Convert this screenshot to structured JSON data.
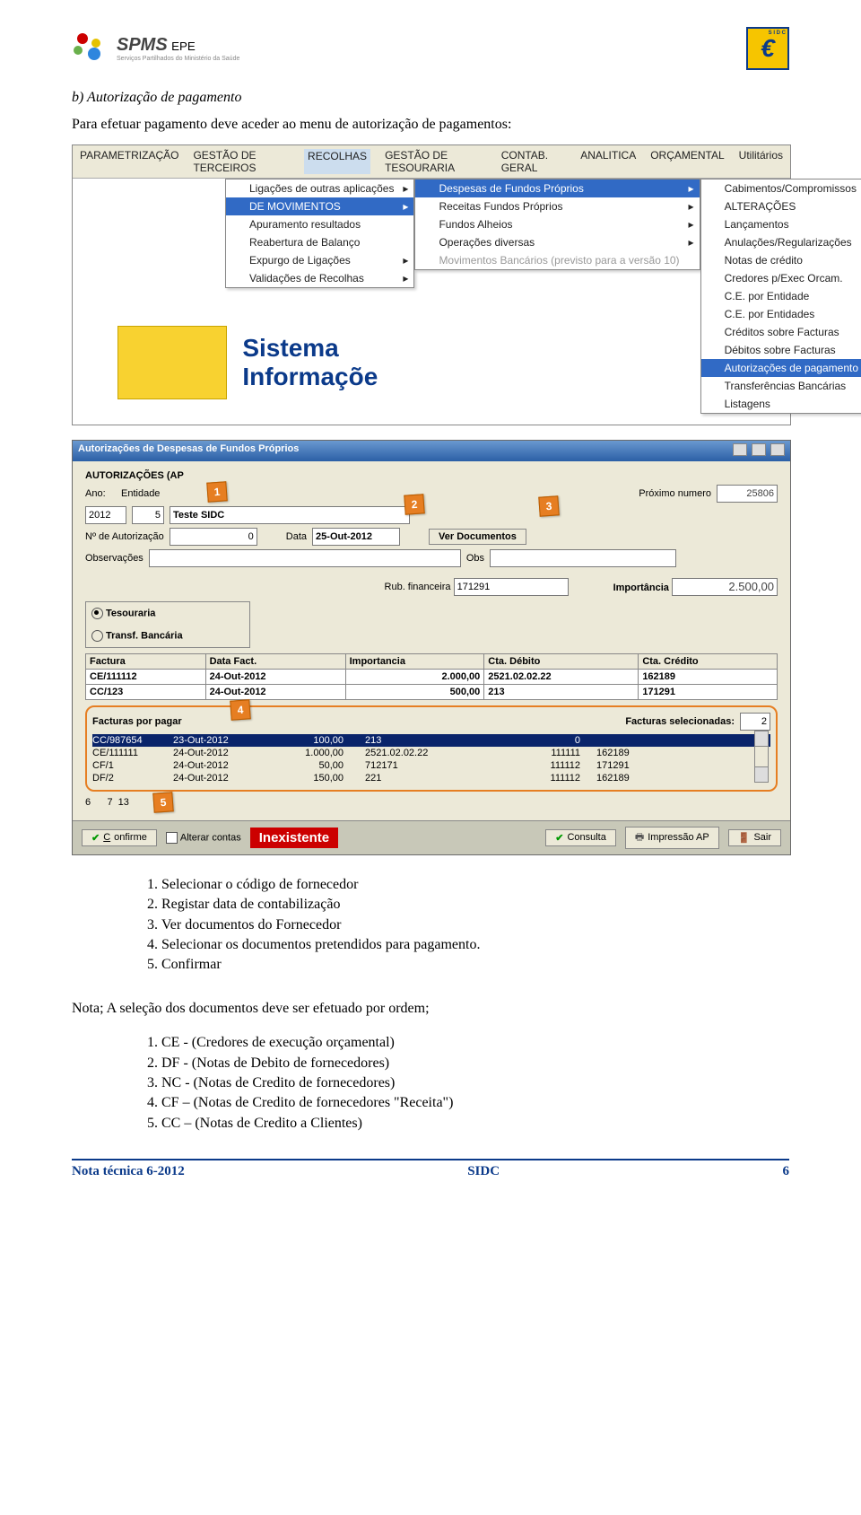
{
  "header": {
    "org_name": "SPMS",
    "org_suffix": "EPE",
    "org_sub": "Serviços Partilhados do Ministério da Saúde",
    "sidc_letters": "S I D C"
  },
  "section": {
    "bullet_b": "b)  Autorização de pagamento",
    "intro": "Para efetuar pagamento deve aceder ao menu de autorização de pagamentos:"
  },
  "menu": {
    "bar": [
      "PARAMETRIZAÇÃO",
      "GESTÃO DE TERCEIROS",
      "RECOLHAS",
      "GESTÃO DE TESOURARIA",
      "CONTAB. GERAL",
      "ANALITICA",
      "ORÇAMENTAL",
      "Utilitários"
    ],
    "col1": [
      {
        "label": "Ligações de outras aplicações",
        "arrow": true
      },
      {
        "label": "DE MOVIMENTOS",
        "arrow": true,
        "sel": true
      },
      {
        "label": "Apuramento resultados"
      },
      {
        "label": "Reabertura de Balanço"
      },
      {
        "label": "Expurgo de Ligações",
        "arrow": true
      },
      {
        "label": "Validações de Recolhas",
        "arrow": true
      }
    ],
    "col2": [
      {
        "label": "Despesas de Fundos Próprios",
        "arrow": true,
        "sel": true
      },
      {
        "label": "Receitas Fundos Próprios",
        "arrow": true
      },
      {
        "label": "Fundos Alheios",
        "arrow": true
      },
      {
        "label": "Operações diversas",
        "arrow": true
      },
      {
        "label": "Movimentos Bancários (previsto para a versão 10)",
        "dis": true
      }
    ],
    "col3": [
      {
        "label": "Cabimentos/Compromissos"
      },
      {
        "label": "ALTERAÇÕES",
        "arrow": true
      },
      {
        "label": "Lançamentos"
      },
      {
        "label": "Anulações/Regularizações"
      },
      {
        "label": "Notas de crédito"
      },
      {
        "label": "Credores p/Exec Orcam."
      },
      {
        "label": "C.E. por Entidade"
      },
      {
        "label": "C.E. por Entidades"
      },
      {
        "label": "Créditos sobre Facturas"
      },
      {
        "label": "Débitos sobre Facturas"
      },
      {
        "label": "Autorizações de pagamento",
        "sel": true
      },
      {
        "label": "Transferências Bancárias"
      },
      {
        "label": "Listagens"
      }
    ],
    "banner1": "Sistema",
    "banner2": "Informaçõe"
  },
  "win": {
    "title": "Autorizações de Despesas de Fundos Próprios",
    "heading": "AUTORIZAÇÕES (AP",
    "lbl_ano": "Ano:",
    "ano": "2012",
    "lbl_ent": "Entidade",
    "ent_code": "5",
    "ent_name": "Teste SIDC",
    "lbl_prox": "Próximo numero",
    "prox": "25806",
    "lbl_naut": "Nº de Autorização",
    "naut": "0",
    "lbl_data": "Data",
    "data": "25-Out-2012",
    "btn_verdoc": "Ver Documentos",
    "lbl_obs": "Observações",
    "lbl_obs2": "Obs",
    "lbl_rub": "Rub. financeira",
    "rub": "171291",
    "lbl_imp": "Importância",
    "imp": "2.500,00",
    "rad_tes": "Tesouraria",
    "rad_tb": "Transf. Bancária",
    "th": [
      "Factura",
      "Data Fact.",
      "Importancia",
      "Cta. Débito",
      "Cta. Crédito"
    ],
    "rows": [
      [
        "CE/111112",
        "24-Out-2012",
        "2.000,00",
        "2521.02.02.22",
        "162189"
      ],
      [
        "CC/123",
        "24-Out-2012",
        "500,00",
        "213",
        "171291"
      ]
    ],
    "fac_title": "Facturas por pagar",
    "fac_sel_lbl": "Facturas selecionadas:",
    "fac_sel": "2",
    "fac": [
      {
        "c1": "CC/987654",
        "c2": "23-Out-2012",
        "c3": "100,00",
        "c4": "213",
        "c5": "0",
        "c6": "",
        "sel": true
      },
      {
        "c1": "CE/111111",
        "c2": "24-Out-2012",
        "c3": "1.000,00",
        "c4": "2521.02.02.22",
        "c5": "111111",
        "c6": "162189"
      },
      {
        "c1": "CF/1",
        "c2": "24-Out-2012",
        "c3": "50,00",
        "c4": "712171",
        "c5": "111112",
        "c6": "171291"
      },
      {
        "c1": "DF/2",
        "c2": "24-Out-2012",
        "c3": "150,00",
        "c4": "221",
        "c5": "111112",
        "c6": "162189"
      }
    ],
    "tot67": "6      7  13",
    "btn_conf": "Confirme",
    "chk_alt": "Alterar contas",
    "inex": "Inexistente",
    "btn_cons": "Consulta",
    "btn_imp": "Impressão AP",
    "btn_sair": "Sair"
  },
  "badges": {
    "b1": "1",
    "b2": "2",
    "b3": "3",
    "b4": "4",
    "b5": "5"
  },
  "steps": {
    "s1": "Selecionar o código de fornecedor",
    "s2": "Registar data de contabilização",
    "s3": "Ver documentos do Fornecedor",
    "s4": "Selecionar os documentos pretendidos para pagamento.",
    "s5": "Confirmar"
  },
  "nota": {
    "head": "Nota; A seleção dos documentos deve ser efetuado por ordem;",
    "i1": "CE - (Credores de execução orçamental)",
    "i2": "DF - (Notas de Debito de fornecedores)",
    "i3": "NC - (Notas de Credito de fornecedores)",
    "i4": "CF – (Notas de Credito de fornecedores \"Receita\")",
    "i5": "CC – (Notas de Credito a Clientes)"
  },
  "footer": {
    "l": "Nota técnica 6-2012",
    "c": "SIDC",
    "r": "6"
  }
}
